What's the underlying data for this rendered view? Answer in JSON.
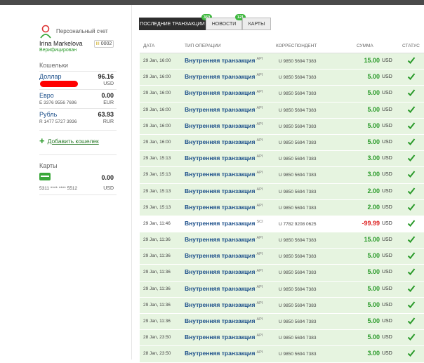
{
  "sidebar": {
    "account_title": "Персональный счет",
    "user_name": "Irina Markelova",
    "verified_label": "Верифицирован",
    "badge_level": "III",
    "badge_value": "0002",
    "wallets_title": "Кошельки",
    "wallets": [
      {
        "name": "Доллар",
        "amount": "96.16",
        "number": "",
        "currency": "USD",
        "redacted": true
      },
      {
        "name": "Евро",
        "amount": "0.00",
        "number": "E 3376 9556 7696",
        "currency": "EUR",
        "redacted": false
      },
      {
        "name": "Рубль",
        "amount": "63.93",
        "number": "R 1477 5727 3936",
        "currency": "RUR",
        "redacted": false
      }
    ],
    "add_wallet_label": "Добавить кошелек",
    "cards_title": "Карты",
    "card": {
      "amount": "0.00",
      "number": "5311 **** **** 5512",
      "currency": "USD"
    }
  },
  "tabs": [
    {
      "label": "ПОСЛЕДНИЕ ТРАНЗАКЦИИ",
      "badge": "360",
      "active": true
    },
    {
      "label": "НОВОСТИ",
      "badge": "121",
      "active": false
    },
    {
      "label": "КАРТЫ",
      "badge": "",
      "active": false
    }
  ],
  "table": {
    "headers": {
      "date": "ДАТА",
      "type": "ТИП ОПЕРАЦИИ",
      "corr": "КОРРЕСПОНДЕНТ",
      "sum": "СУММА",
      "status": "СТАТУС"
    },
    "rows": [
      {
        "date": "29 Jan, 16:00",
        "type": "Внутренняя транзакция",
        "tag": "API",
        "corr": "U 9850 5694 7383",
        "sum": "15.00",
        "cur": "USD",
        "dir": "in"
      },
      {
        "date": "29 Jan, 16:00",
        "type": "Внутренняя транзакция",
        "tag": "API",
        "corr": "U 9850 5694 7383",
        "sum": "5.00",
        "cur": "USD",
        "dir": "in"
      },
      {
        "date": "29 Jan, 16:00",
        "type": "Внутренняя транзакция",
        "tag": "API",
        "corr": "U 9850 5694 7383",
        "sum": "5.00",
        "cur": "USD",
        "dir": "in"
      },
      {
        "date": "29 Jan, 16:00",
        "type": "Внутренняя транзакция",
        "tag": "API",
        "corr": "U 9850 5694 7383",
        "sum": "5.00",
        "cur": "USD",
        "dir": "in"
      },
      {
        "date": "29 Jan, 16:00",
        "type": "Внутренняя транзакция",
        "tag": "API",
        "corr": "U 9850 5694 7383",
        "sum": "5.00",
        "cur": "USD",
        "dir": "in"
      },
      {
        "date": "29 Jan, 16:00",
        "type": "Внутренняя транзакция",
        "tag": "API",
        "corr": "U 9850 5694 7383",
        "sum": "5.00",
        "cur": "USD",
        "dir": "in"
      },
      {
        "date": "29 Jan, 15:13",
        "type": "Внутренняя транзакция",
        "tag": "API",
        "corr": "U 9850 5694 7383",
        "sum": "3.00",
        "cur": "USD",
        "dir": "in"
      },
      {
        "date": "29 Jan, 15:13",
        "type": "Внутренняя транзакция",
        "tag": "API",
        "corr": "U 9850 5694 7383",
        "sum": "3.00",
        "cur": "USD",
        "dir": "in"
      },
      {
        "date": "29 Jan, 15:13",
        "type": "Внутренняя транзакция",
        "tag": "API",
        "corr": "U 9850 5694 7383",
        "sum": "2.00",
        "cur": "USD",
        "dir": "in"
      },
      {
        "date": "29 Jan, 15:13",
        "type": "Внутренняя транзакция",
        "tag": "API",
        "corr": "U 9850 5694 7383",
        "sum": "2.00",
        "cur": "USD",
        "dir": "in"
      },
      {
        "date": "29 Jan, 11:46",
        "type": "Внутренняя транзакция",
        "tag": "SCI",
        "corr": "U 7782 9208 0625",
        "sum": "-99.99",
        "cur": "USD",
        "dir": "out"
      },
      {
        "date": "29 Jan, 11:36",
        "type": "Внутренняя транзакция",
        "tag": "API",
        "corr": "U 9850 5694 7383",
        "sum": "15.00",
        "cur": "USD",
        "dir": "in"
      },
      {
        "date": "29 Jan, 11:36",
        "type": "Внутренняя транзакция",
        "tag": "API",
        "corr": "U 9850 5694 7383",
        "sum": "5.00",
        "cur": "USD",
        "dir": "in"
      },
      {
        "date": "29 Jan, 11:36",
        "type": "Внутренняя транзакция",
        "tag": "API",
        "corr": "U 9850 5694 7383",
        "sum": "5.00",
        "cur": "USD",
        "dir": "in"
      },
      {
        "date": "29 Jan, 11:36",
        "type": "Внутренняя транзакция",
        "tag": "API",
        "corr": "U 9850 5694 7383",
        "sum": "5.00",
        "cur": "USD",
        "dir": "in"
      },
      {
        "date": "29 Jan, 11:36",
        "type": "Внутренняя транзакция",
        "tag": "API",
        "corr": "U 9850 5694 7383",
        "sum": "5.00",
        "cur": "USD",
        "dir": "in"
      },
      {
        "date": "29 Jan, 11:36",
        "type": "Внутренняя транзакция",
        "tag": "API",
        "corr": "U 9850 5694 7383",
        "sum": "5.00",
        "cur": "USD",
        "dir": "in"
      },
      {
        "date": "28 Jan, 23:50",
        "type": "Внутренняя транзакция",
        "tag": "API",
        "corr": "U 9850 5694 7383",
        "sum": "5.00",
        "cur": "USD",
        "dir": "in"
      },
      {
        "date": "28 Jan, 23:50",
        "type": "Внутренняя транзакция",
        "tag": "API",
        "corr": "U 9850 5694 7383",
        "sum": "3.00",
        "cur": "USD",
        "dir": "in"
      }
    ]
  },
  "colors": {
    "accent_green": "#2a9a2a",
    "link_blue": "#1c4f8a",
    "negative_red": "#d22222",
    "row_in_bg": "#e6f4e0"
  }
}
